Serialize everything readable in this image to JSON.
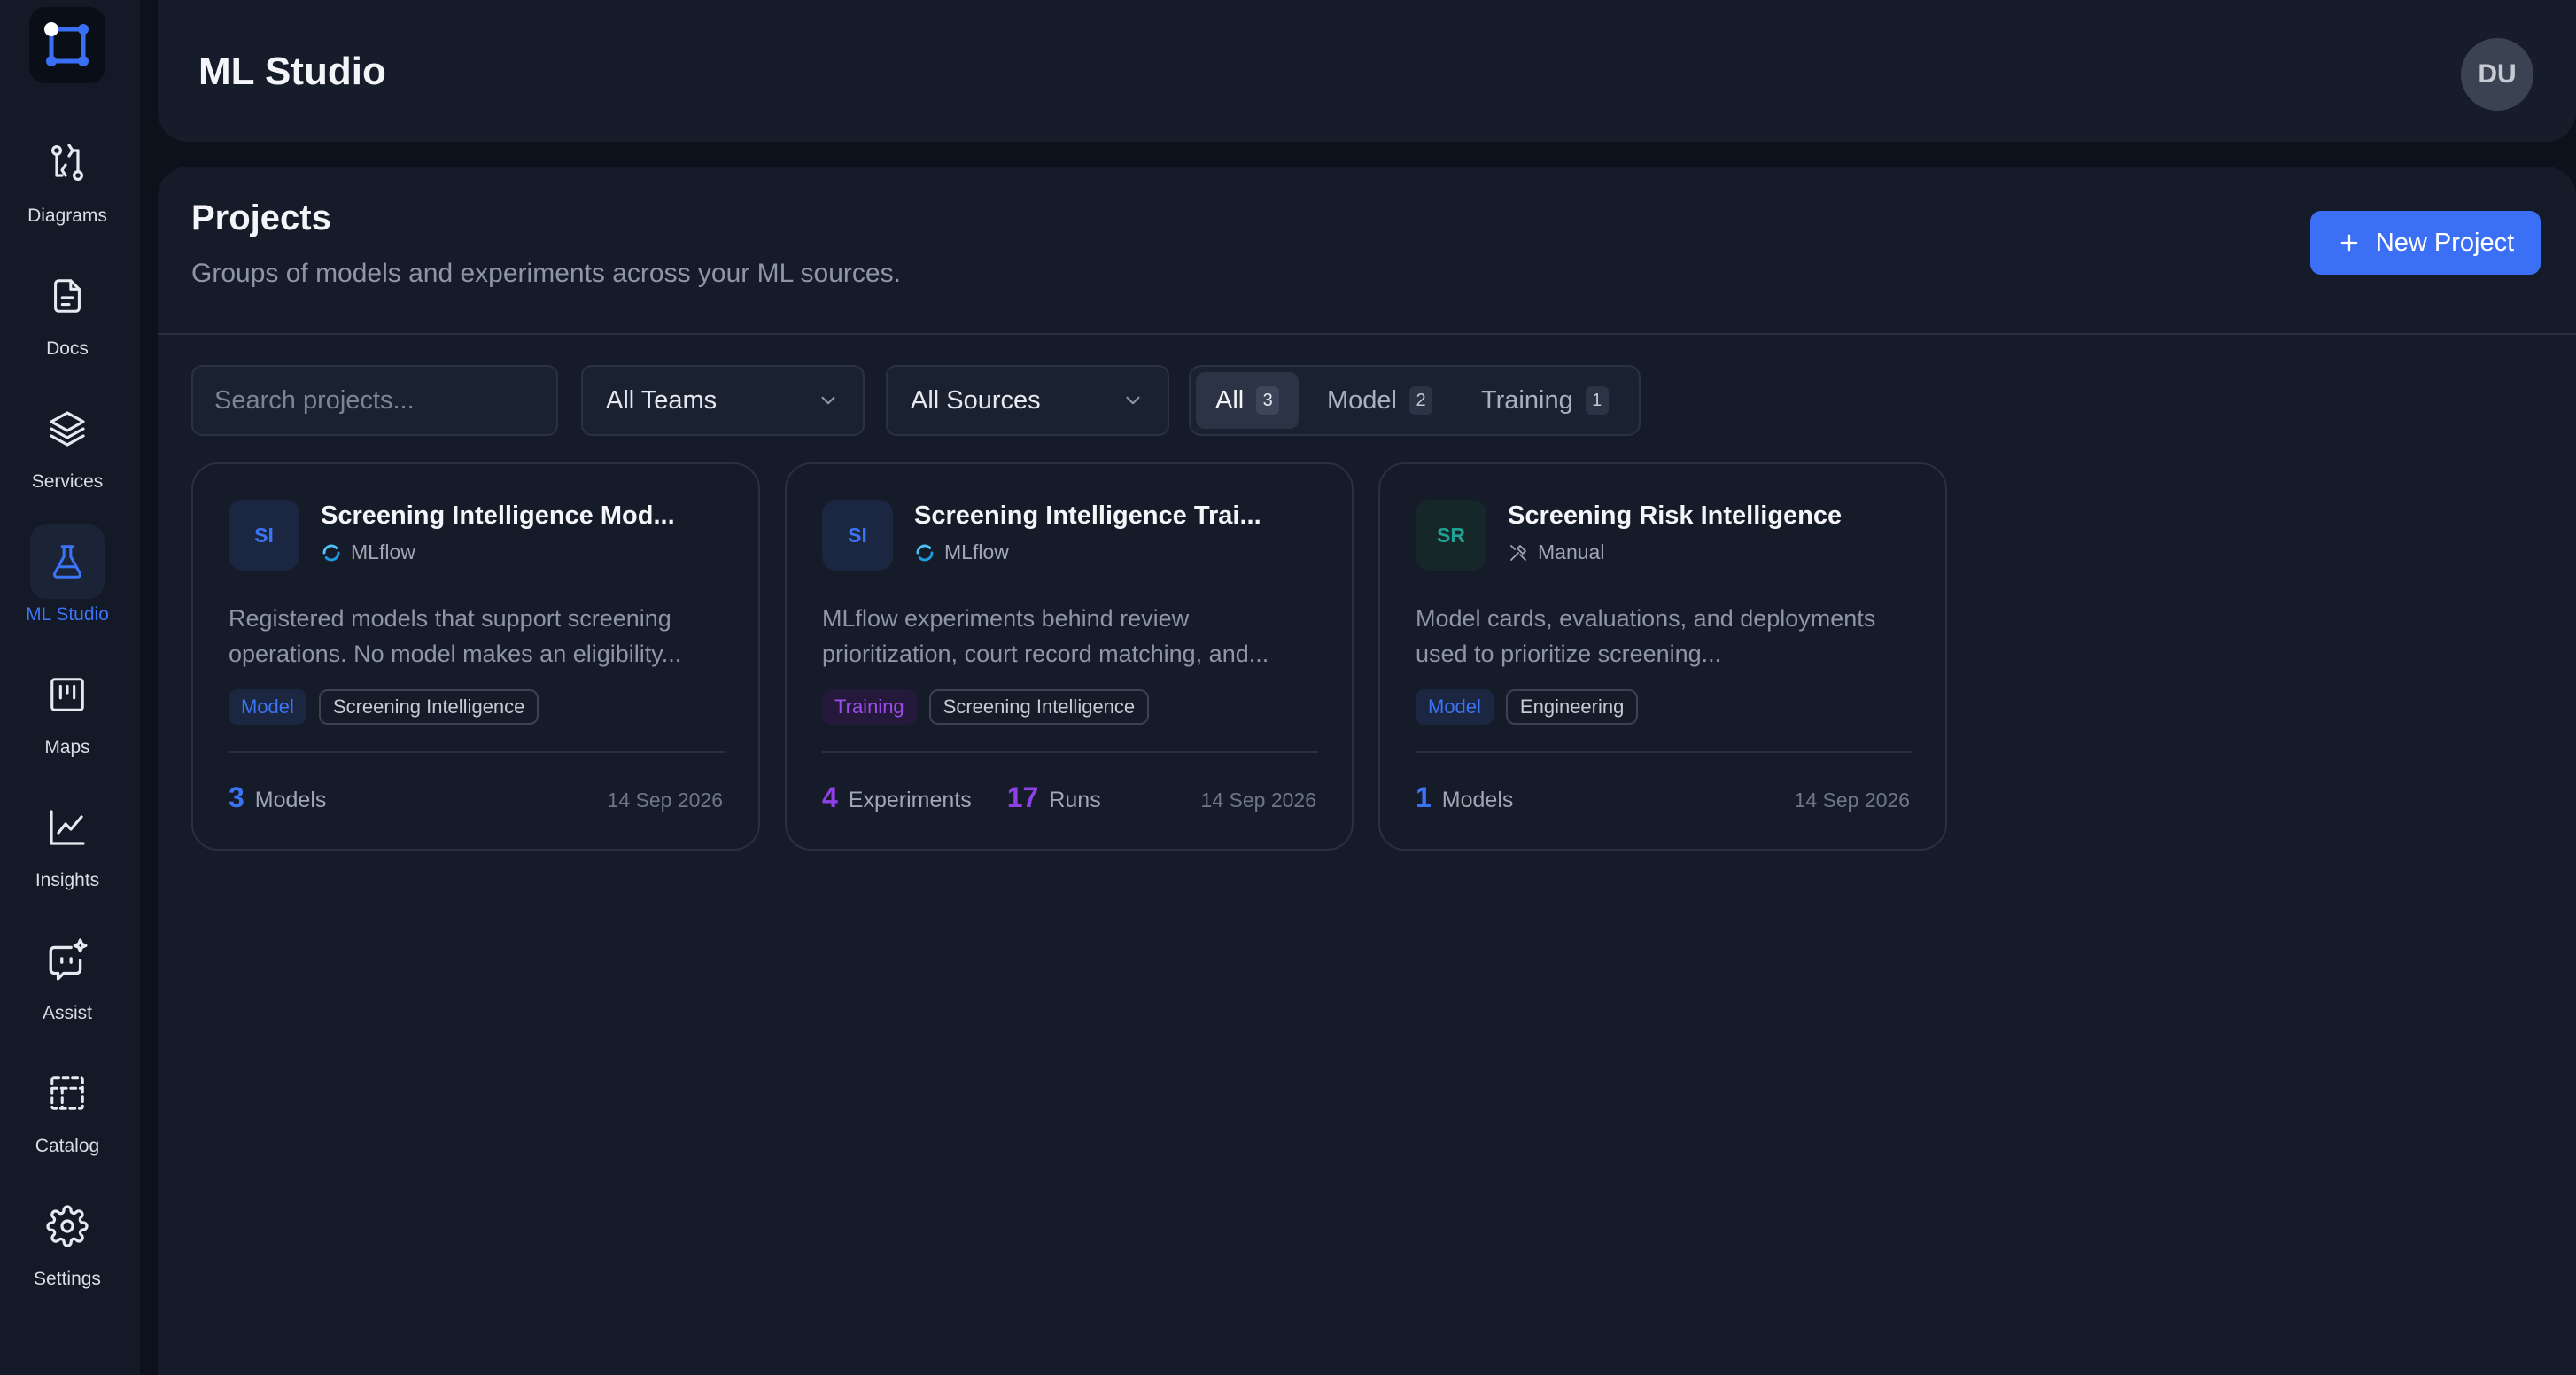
{
  "app": {
    "title": "ML Studio",
    "avatar_initials": "DU"
  },
  "sidebar": {
    "items": [
      {
        "label": "Diagrams",
        "icon": "git-compare-icon"
      },
      {
        "label": "Docs",
        "icon": "document-icon"
      },
      {
        "label": "Services",
        "icon": "layers-icon"
      },
      {
        "label": "ML Studio",
        "icon": "flask-icon",
        "active": true
      },
      {
        "label": "Maps",
        "icon": "kanban-icon"
      },
      {
        "label": "Insights",
        "icon": "line-chart-icon"
      },
      {
        "label": "Assist",
        "icon": "sparkle-chat-icon"
      },
      {
        "label": "Catalog",
        "icon": "dashed-grid-icon"
      },
      {
        "label": "Settings",
        "icon": "gear-icon"
      }
    ]
  },
  "page": {
    "title": "Projects",
    "subtitle": "Groups of models and experiments across your ML sources.",
    "new_button": "New Project"
  },
  "filters": {
    "search_placeholder": "Search projects...",
    "teams": "All Teams",
    "sources": "All Sources",
    "segments": [
      {
        "label": "All",
        "count": "3",
        "active": true
      },
      {
        "label": "Model",
        "count": "2"
      },
      {
        "label": "Training",
        "count": "1"
      }
    ]
  },
  "cards": [
    {
      "initials": "SI",
      "title": "Screening Intelligence Mod...",
      "source": "MLflow",
      "description": "Registered models that support screening operations. No model makes an eligibility...",
      "tags": [
        "Model",
        "Screening Intelligence"
      ],
      "stats": [
        {
          "num": "3",
          "label": "Models"
        }
      ],
      "date": "14 Sep 2026"
    },
    {
      "initials": "SI",
      "title": "Screening Intelligence Trai...",
      "source": "MLflow",
      "description": "MLflow experiments behind review prioritization, court record matching, and...",
      "tags": [
        "Training",
        "Screening Intelligence"
      ],
      "stats": [
        {
          "num": "4",
          "label": "Experiments"
        },
        {
          "num": "17",
          "label": "Runs"
        }
      ],
      "date": "14 Sep 2026"
    },
    {
      "initials": "SR",
      "title": "Screening Risk Intelligence",
      "source": "Manual",
      "description": "Model cards, evaluations, and deployments used to prioritize screening...",
      "tags": [
        "Model",
        "Engineering"
      ],
      "stats": [
        {
          "num": "1",
          "label": "Models"
        }
      ],
      "date": "14 Sep 2026"
    }
  ],
  "colors": {
    "accent": "#3b6ff5",
    "background": "#0d111b",
    "panel": "#151b28",
    "training": "#8c40e6",
    "teal": "#21a191"
  }
}
